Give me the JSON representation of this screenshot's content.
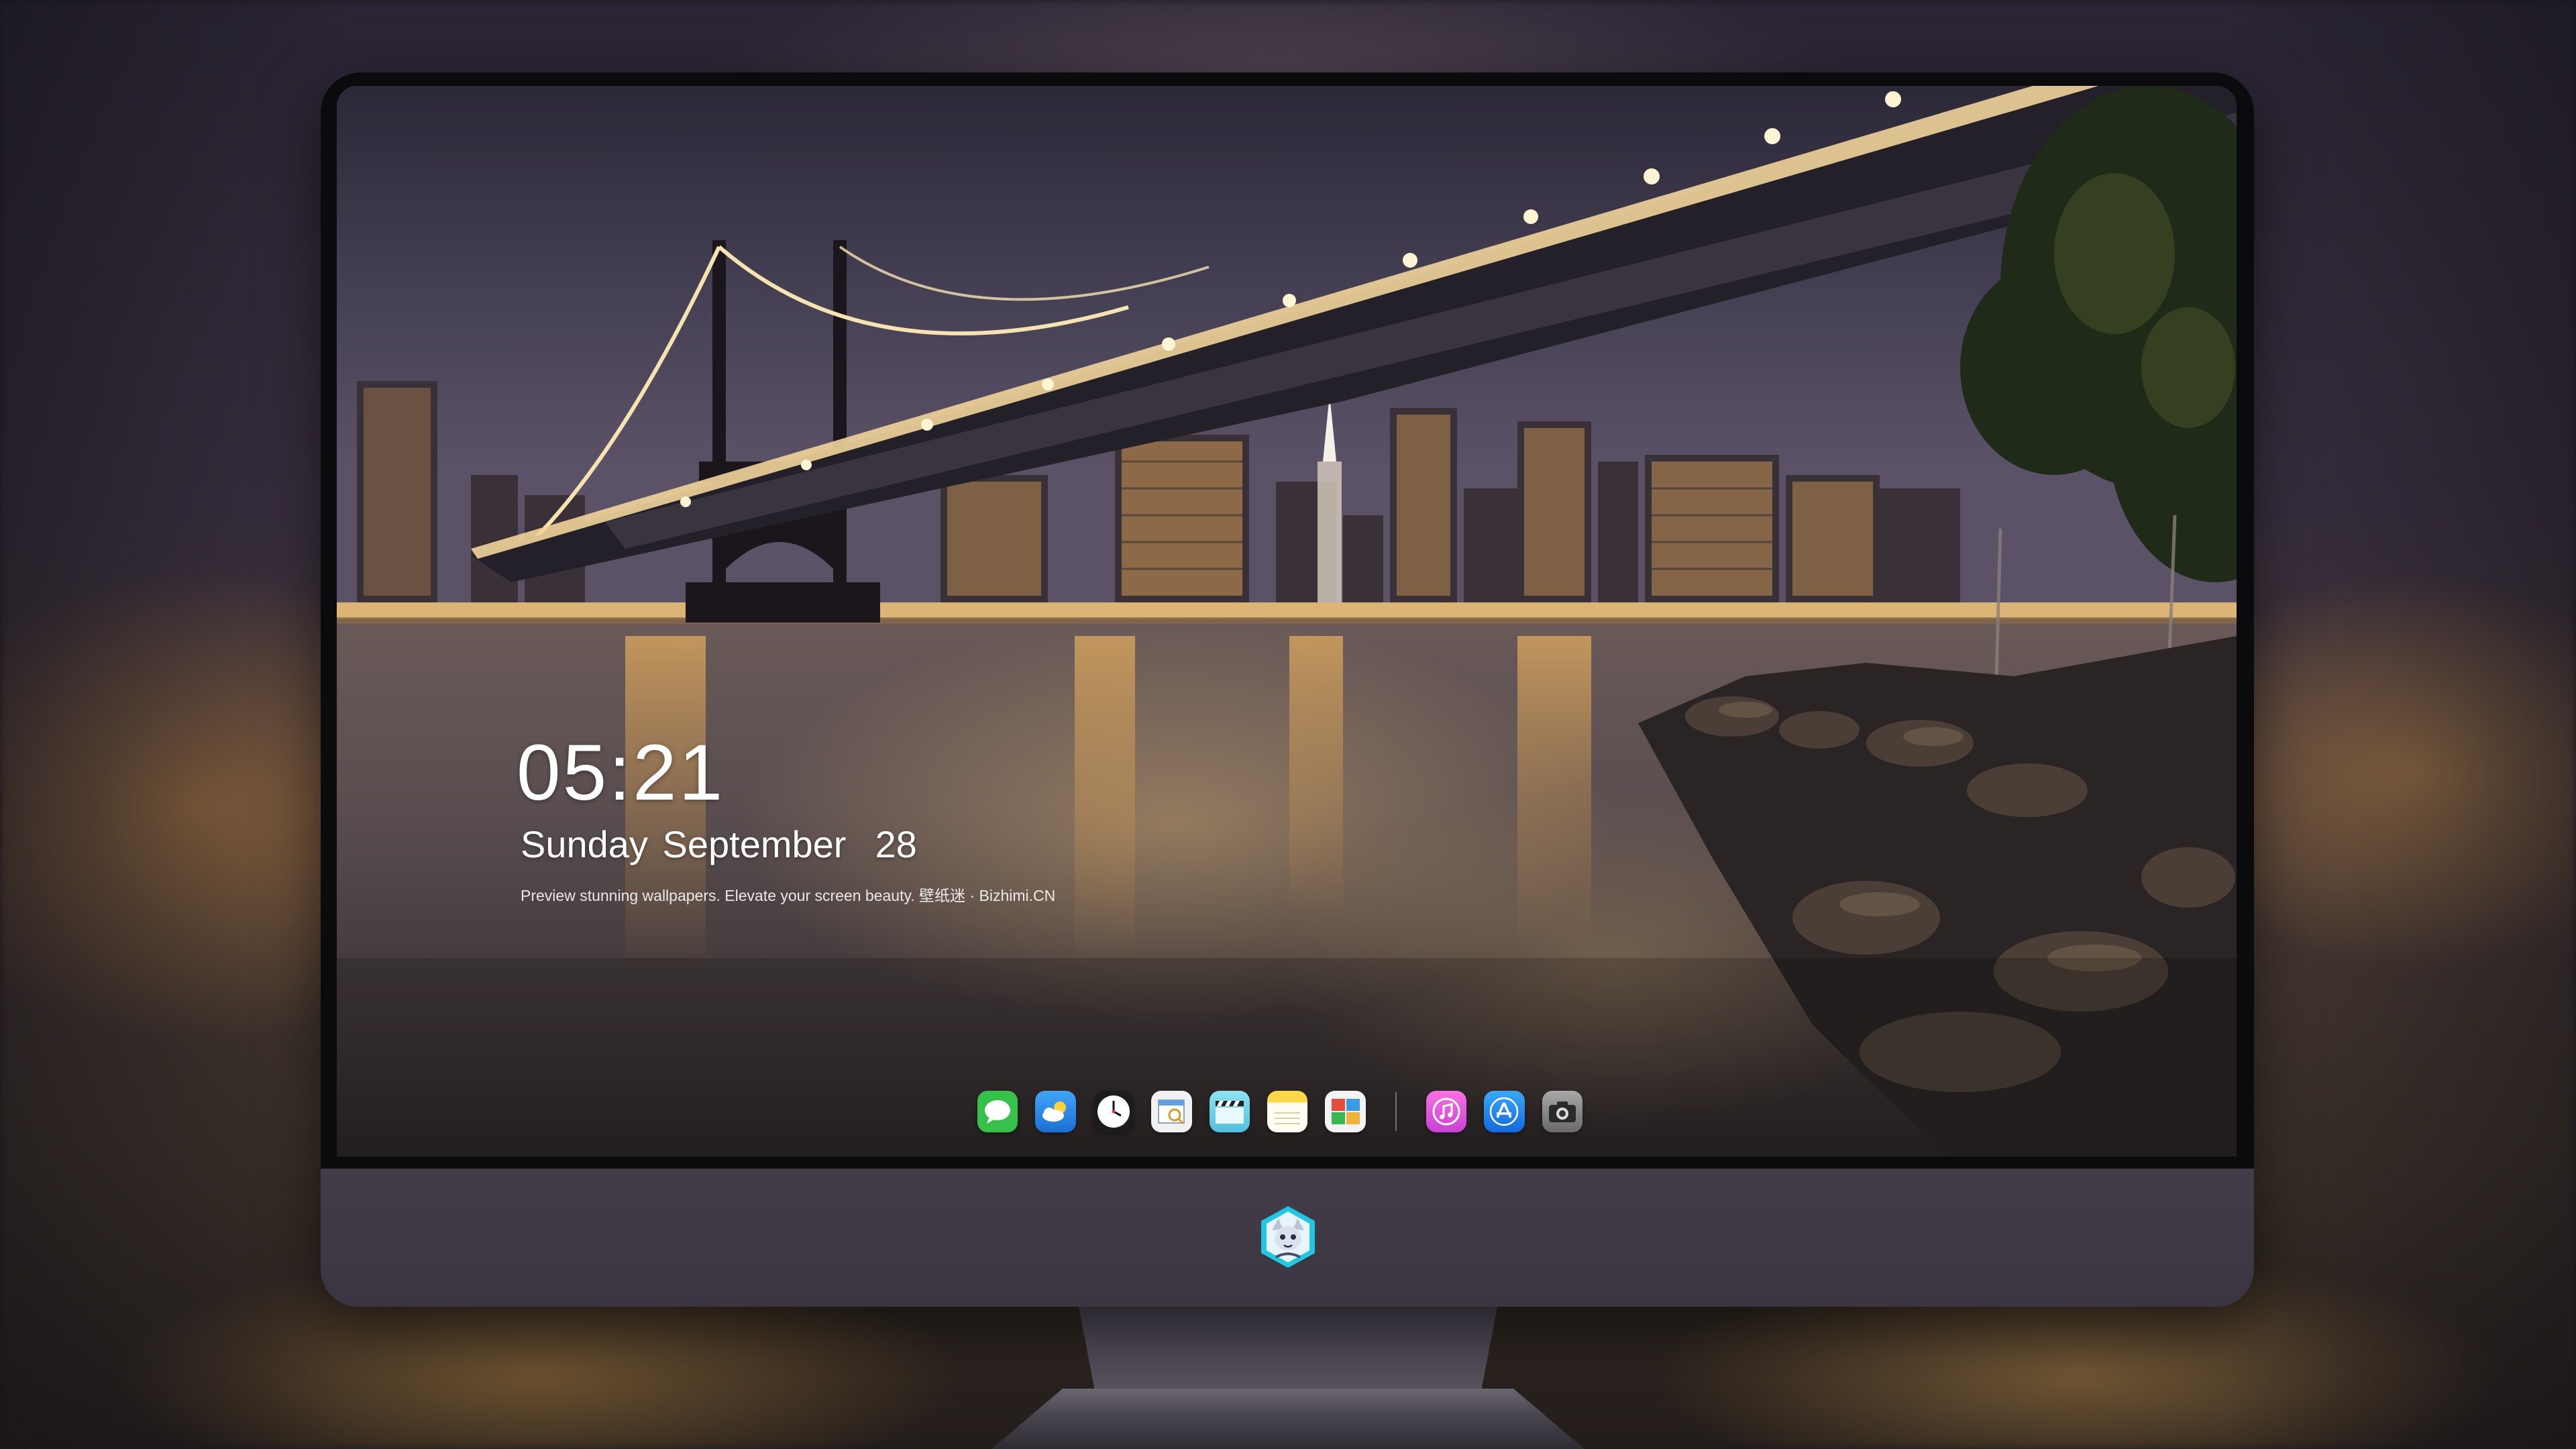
{
  "lockscreen": {
    "time": "05:21",
    "date": "Sunday September  28",
    "tagline": "Preview stunning wallpapers. Elevate your screen beauty. 壁纸迷 · Bizhimi.CN"
  },
  "dock": {
    "apps": [
      {
        "icon": "messages-icon",
        "color": "#36c24a"
      },
      {
        "icon": "weather-icon",
        "color": "#2f8ff0"
      },
      {
        "icon": "clock-icon",
        "color": "#1c1c1e"
      },
      {
        "icon": "preview-icon",
        "color": "#f1f1f1"
      },
      {
        "icon": "video-icon",
        "color": "#6fd4e8"
      },
      {
        "icon": "notes-icon",
        "color": "#ffd84a"
      },
      {
        "icon": "photo-booth-icon",
        "color": "#f3f3f3"
      },
      {
        "icon": "music-icon",
        "color": "#f05bd8"
      },
      {
        "icon": "app-store-icon",
        "color": "#1d8cf2"
      },
      {
        "icon": "camera-icon",
        "color": "#8c8c8c"
      }
    ]
  },
  "brand": {
    "logo": "dragon-mascot-logo",
    "accent": "#1ec8e0"
  }
}
